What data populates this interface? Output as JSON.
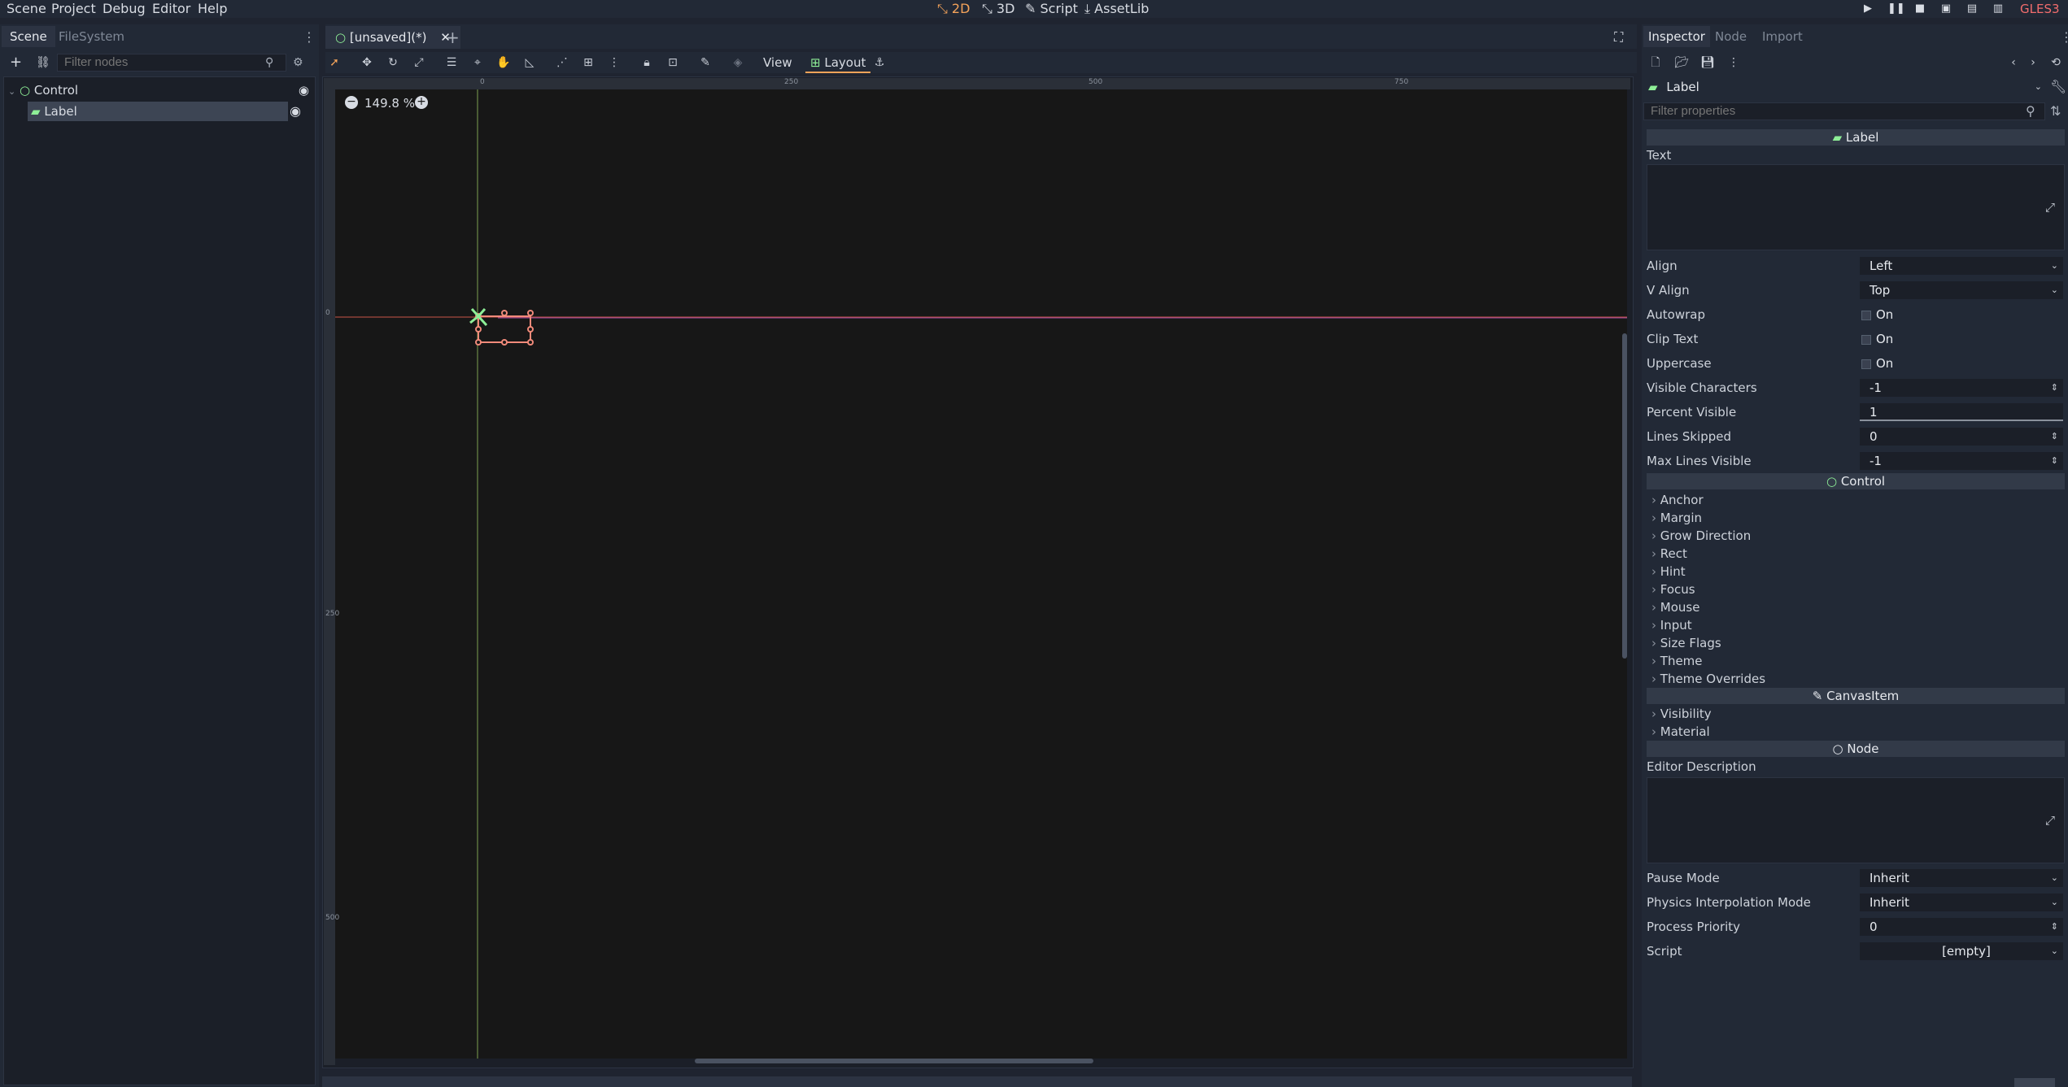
{
  "menubar": {
    "items": [
      "Scene",
      "Project",
      "Debug",
      "Editor",
      "Help"
    ],
    "modes": [
      {
        "label": "2D",
        "active": true
      },
      {
        "label": "3D",
        "active": false
      },
      {
        "label": "Script",
        "active": false
      },
      {
        "label": "AssetLib",
        "active": false
      }
    ],
    "renderer": "GLES3"
  },
  "scene_dock": {
    "tabs": [
      "Scene",
      "FileSystem"
    ],
    "filter_placeholder": "Filter nodes",
    "tree": [
      {
        "name": "Control",
        "icon": "control-node-icon",
        "selected": false
      },
      {
        "name": "Label",
        "icon": "label-node-icon",
        "selected": true
      }
    ]
  },
  "editor": {
    "scene_tab": "[unsaved](*)",
    "view_label": "View",
    "layout_label": "Layout",
    "zoom": "149.8 %",
    "ruler_marks": [
      "0",
      "250",
      "500",
      "750"
    ],
    "ruler_left_marks": [
      "0",
      "250",
      "500"
    ]
  },
  "inspector": {
    "tabs": [
      "Inspector",
      "Node",
      "Import"
    ],
    "object_name": "Label",
    "filter_placeholder": "Filter properties",
    "sections": {
      "label": "Label",
      "control": "Control",
      "canvas_item": "CanvasItem",
      "node": "Node"
    },
    "text_label": "Text",
    "props_label": [
      {
        "label": "Align",
        "value": "Left",
        "kind": "dropdown"
      },
      {
        "label": "V Align",
        "value": "Top",
        "kind": "dropdown"
      },
      {
        "label": "Autowrap",
        "value": "On",
        "kind": "check"
      },
      {
        "label": "Clip Text",
        "value": "On",
        "kind": "check"
      },
      {
        "label": "Uppercase",
        "value": "On",
        "kind": "check"
      },
      {
        "label": "Visible Characters",
        "value": "-1",
        "kind": "spin"
      },
      {
        "label": "Percent Visible",
        "value": "1",
        "kind": "slider"
      },
      {
        "label": "Lines Skipped",
        "value": "0",
        "kind": "spin"
      },
      {
        "label": "Max Lines Visible",
        "value": "-1",
        "kind": "spin"
      }
    ],
    "control_groups": [
      "Anchor",
      "Margin",
      "Grow Direction",
      "Rect",
      "Hint",
      "Focus",
      "Mouse",
      "Input",
      "Size Flags",
      "Theme",
      "Theme Overrides"
    ],
    "canvas_groups": [
      "Visibility",
      "Material"
    ],
    "editor_description_label": "Editor Description",
    "node_props": [
      {
        "label": "Pause Mode",
        "value": "Inherit",
        "kind": "dropdown"
      },
      {
        "label": "Physics Interpolation Mode",
        "value": "Inherit",
        "kind": "dropdown"
      },
      {
        "label": "Process Priority",
        "value": "0",
        "kind": "spin"
      },
      {
        "label": "Script",
        "value": "[empty]",
        "kind": "dropdown"
      }
    ]
  },
  "colors": {
    "accent_orange": "#f4a35a",
    "selection_green": "#8eef97",
    "guide_red": "#c8544a",
    "guide_green": "#7ea050",
    "handle_orange": "#f08a7a"
  }
}
